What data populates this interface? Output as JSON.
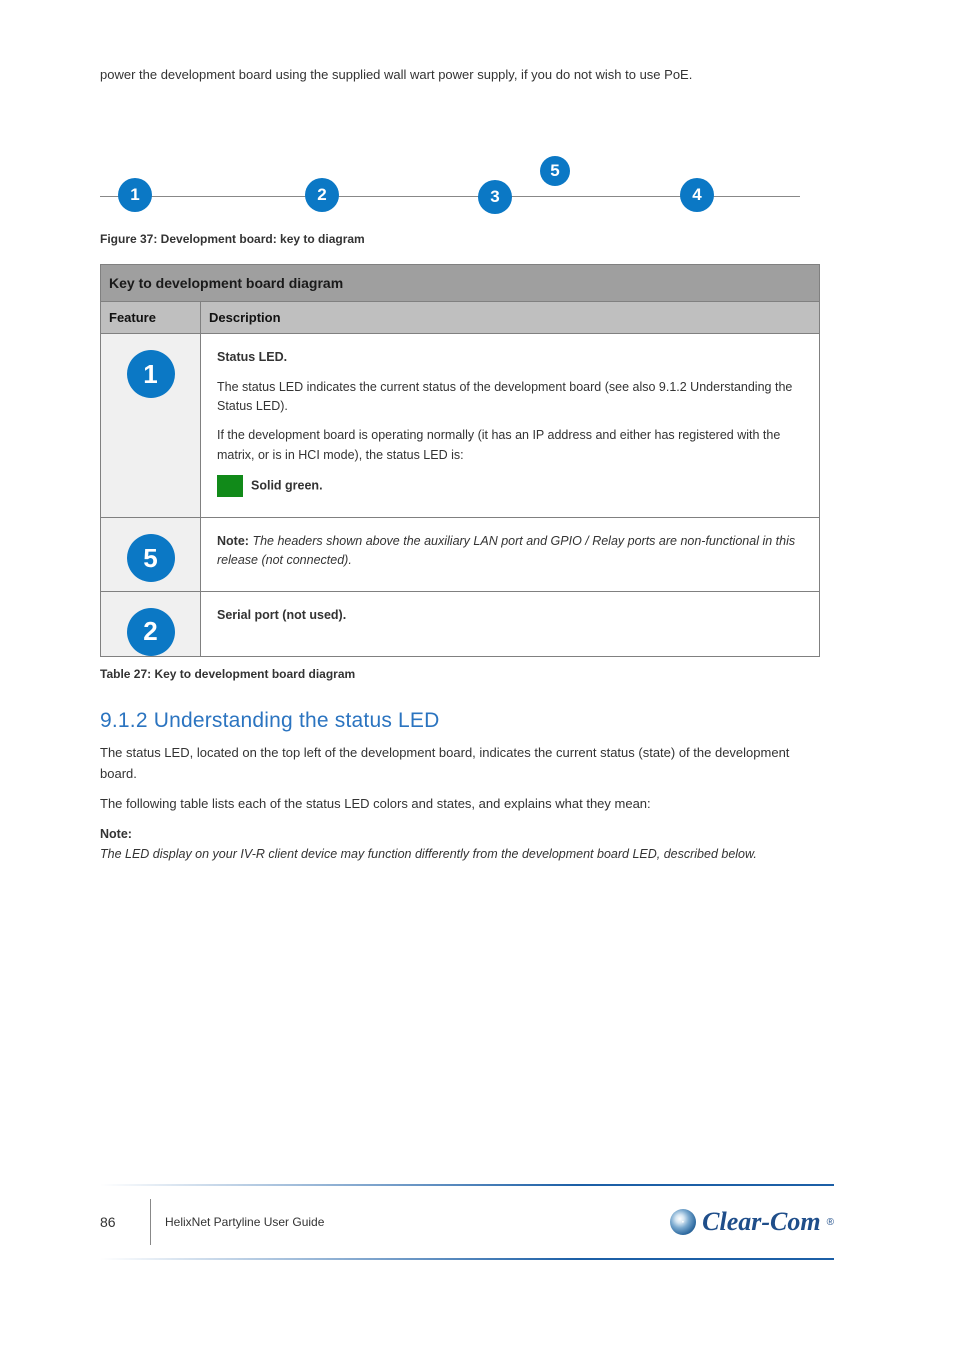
{
  "intro": "power the development board using the supplied wall wart power supply, if you do not wish to use PoE.",
  "figure": {
    "caption_label": "Figure 37: Development board: key to diagram",
    "dot1": "1",
    "dot2": "2",
    "dot3": "3",
    "dot4": "4",
    "dot5": "5"
  },
  "table": {
    "title": "Key to development board diagram",
    "col_feature": "Feature",
    "col_desc": "Description",
    "row1_num": "1",
    "row1_p1": "Status LED.",
    "row1_p2": "The status LED indicates the current status of the development board (see also 9.1.2 Understanding the Status LED).",
    "row1_p3": "If the development board is operating normally (it has an IP address and either has registered with the matrix, or is in HCI mode), the status LED is:",
    "row1_p4": "Solid green.",
    "row2_num": "5",
    "row2_p1_label": "Note:",
    "row2_p1_body": "The headers shown above the auxiliary LAN port and GPIO / Relay ports are non-functional in this release (not connected).",
    "row3_num": "2",
    "row3_p1": "Serial port (not used).",
    "caption": "Table 27: Key to development board diagram"
  },
  "section": {
    "heading": "9.1.2 Understanding the status LED",
    "p1": "The status LED, located on the top left of the development board, indicates the current status (state) of the development board.",
    "p2": "The following table lists each of the status LED colors and states, and explains what they mean:",
    "note_label": "Note:",
    "note_body": "The LED display on your IV-R client device may function differently from the development board LED, described below."
  },
  "footer": {
    "page": "86",
    "doc": "HelixNet Partyline User Guide",
    "brand_text": "Clear-Com",
    "brand_orb_glyph": "·"
  }
}
